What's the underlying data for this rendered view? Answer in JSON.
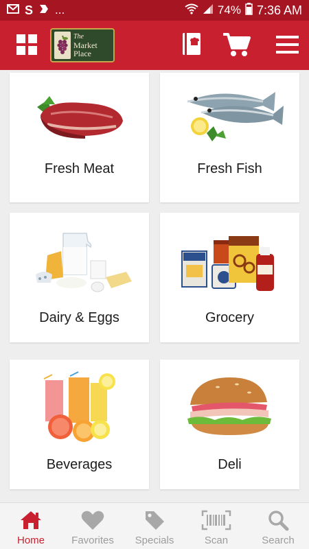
{
  "status_bar": {
    "left_icons": [
      "gmail-icon",
      "s-icon",
      "flag-icon"
    ],
    "s_glyph": "S",
    "overflow": "...",
    "battery": "74%",
    "time": "7:36 AM"
  },
  "app_bar": {
    "brand_color": "#c9202f",
    "logo": {
      "line1": "The",
      "line2": "Market",
      "line3": "Place"
    },
    "icons": [
      "grid-icon",
      "recipe-book-icon",
      "cart-icon",
      "menu-icon"
    ]
  },
  "categories": [
    {
      "label": "Fresh Meat",
      "icon": "fresh-meat-image"
    },
    {
      "label": "Fresh Fish",
      "icon": "fresh-fish-image"
    },
    {
      "label": "Dairy & Eggs",
      "icon": "dairy-eggs-image"
    },
    {
      "label": "Grocery",
      "icon": "grocery-image"
    },
    {
      "label": "Beverages",
      "icon": "beverages-image"
    },
    {
      "label": "Deli",
      "icon": "deli-image"
    }
  ],
  "bottom_nav": {
    "active_color": "#c9202f",
    "inactive_color": "#9c9c9c",
    "items": [
      {
        "label": "Home",
        "icon": "home-icon",
        "active": true
      },
      {
        "label": "Favorites",
        "icon": "heart-icon",
        "active": false
      },
      {
        "label": "Specials",
        "icon": "tag-icon",
        "active": false
      },
      {
        "label": "Scan",
        "icon": "barcode-icon",
        "active": false
      },
      {
        "label": "Search",
        "icon": "search-icon",
        "active": false
      }
    ]
  }
}
